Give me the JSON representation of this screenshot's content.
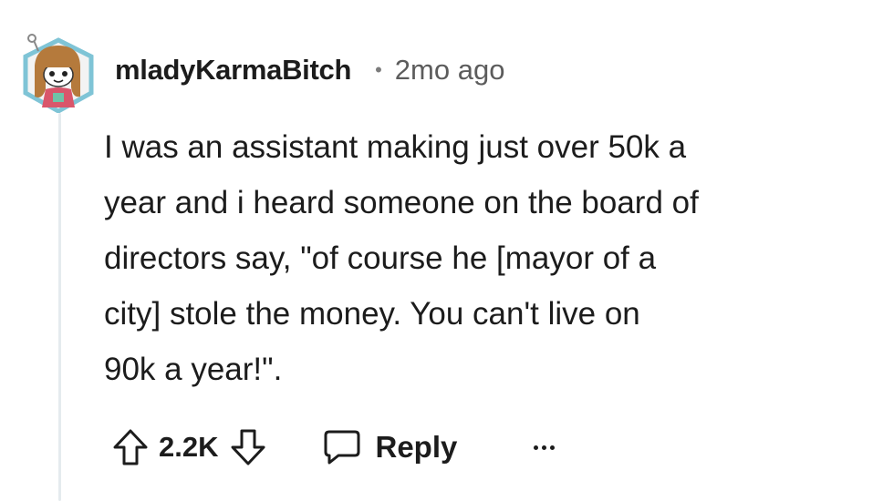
{
  "comment": {
    "username": "mladyKarmaBitch",
    "separator": "•",
    "timestamp": "2mo ago",
    "text": "I was an assistant making just over 50k a\nyear and i heard someone on the board of\ndirectors say, \"of course he [mayor of a\ncity] stole the money. You can't live on\n90k a year!\"."
  },
  "actions": {
    "upvote_icon": "arrow-up-outline-icon",
    "vote_count": "2.2K",
    "downvote_icon": "arrow-down-outline-icon",
    "reply_icon": "speech-bubble-icon",
    "reply_label": "Reply",
    "more_icon": "ellipsis-icon"
  },
  "colors": {
    "text": "#1c1c1c",
    "muted": "#5c5c5c",
    "thread_line": "#e5ebee",
    "avatar_accent": "#7fc4d6"
  }
}
